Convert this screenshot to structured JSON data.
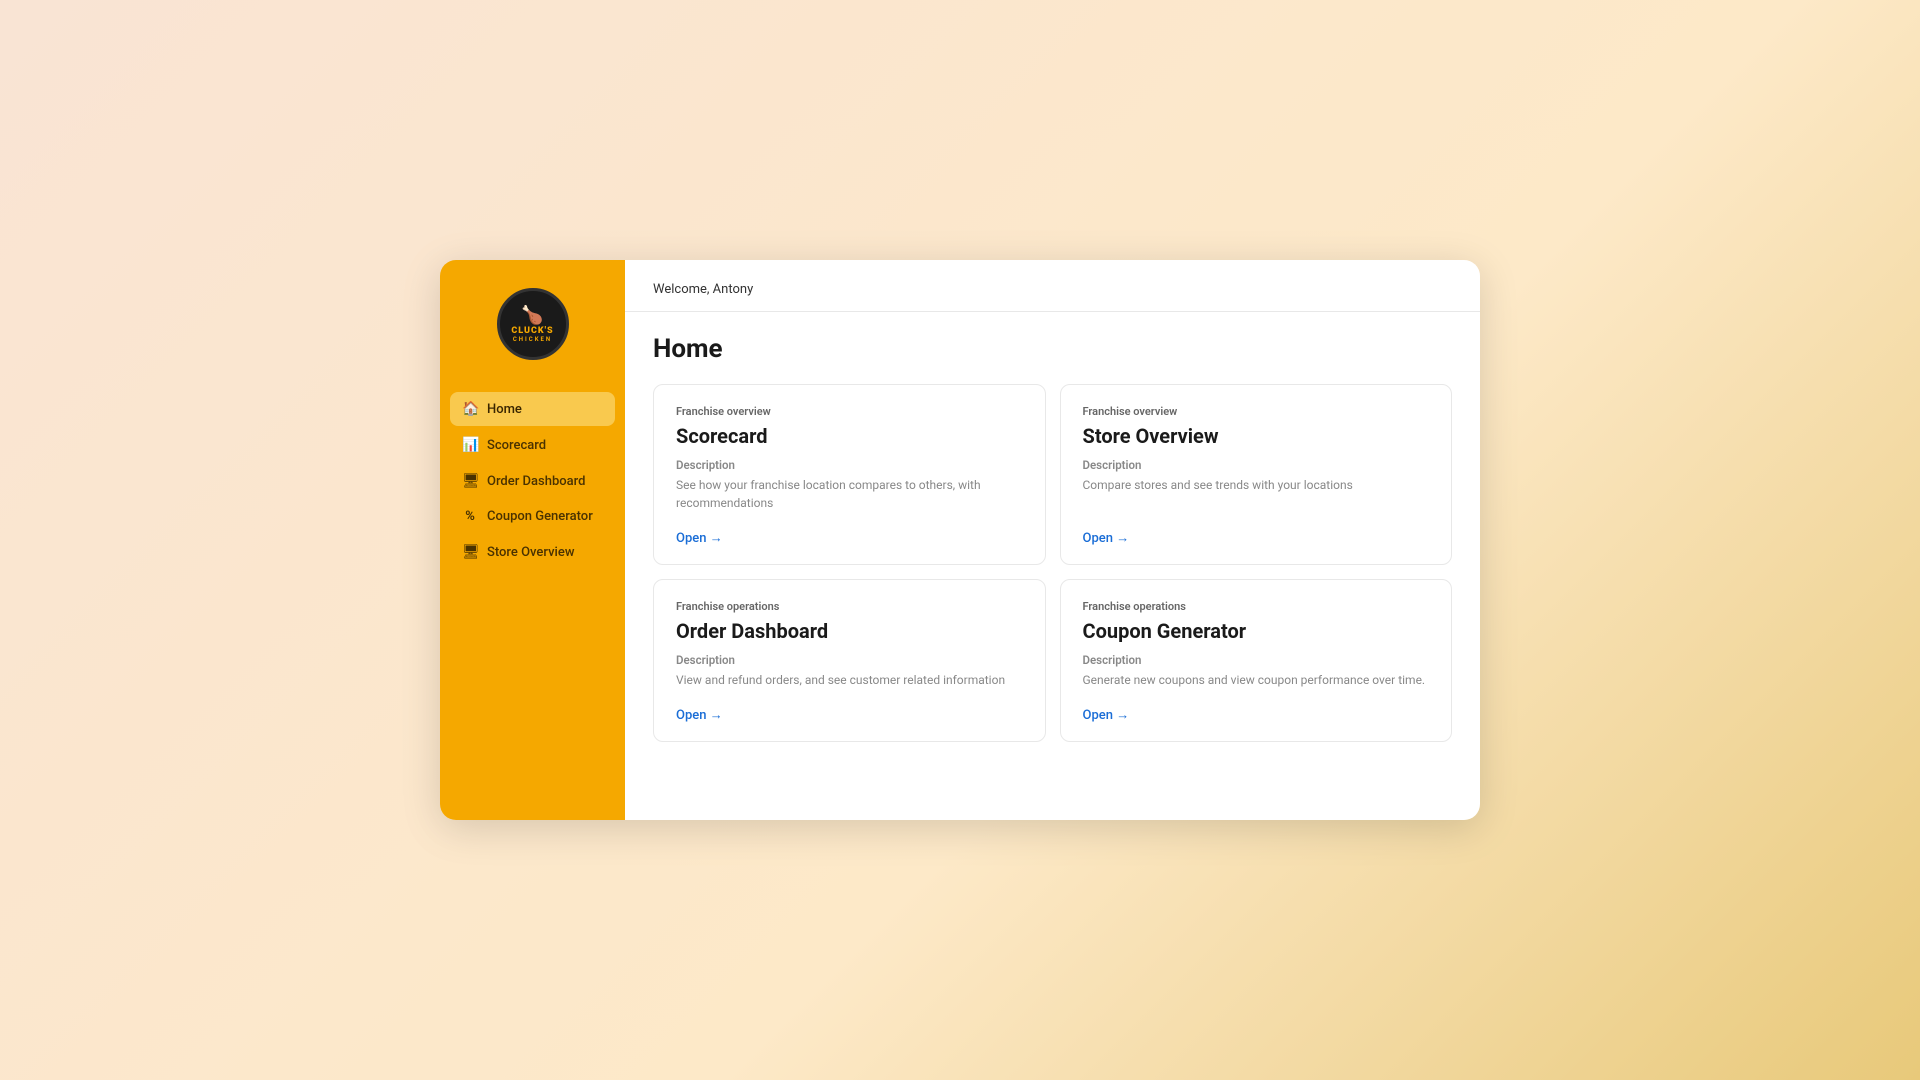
{
  "welcome": {
    "text": "Welcome, Antony"
  },
  "page": {
    "title": "Home"
  },
  "logo": {
    "line1": "CLUCK'S",
    "line2": "CHICKEN",
    "icon": "🍗"
  },
  "sidebar": {
    "items": [
      {
        "id": "home",
        "label": "Home",
        "icon": "🏠",
        "active": true
      },
      {
        "id": "scorecard",
        "label": "Scorecard",
        "icon": "📊",
        "active": false
      },
      {
        "id": "order-dashboard",
        "label": "Order Dashboard",
        "icon": "🖥",
        "active": false
      },
      {
        "id": "coupon-generator",
        "label": "Coupon Generator",
        "icon": "%",
        "active": false
      },
      {
        "id": "store-overview",
        "label": "Store Overview",
        "icon": "🖥",
        "active": false
      }
    ]
  },
  "cards": [
    {
      "id": "scorecard",
      "category": "Franchise overview",
      "title": "Scorecard",
      "desc_label": "Description",
      "description": "See how your franchise location compares to others, with recommendations",
      "open_label": "Open →"
    },
    {
      "id": "store-overview",
      "category": "Franchise overview",
      "title": "Store Overview",
      "desc_label": "Description",
      "description": "Compare stores and see trends with your locations",
      "open_label": "Open →"
    },
    {
      "id": "order-dashboard",
      "category": "Franchise operations",
      "title": "Order Dashboard",
      "desc_label": "Description",
      "description": "View and refund orders, and see customer related information",
      "open_label": "Open →"
    },
    {
      "id": "coupon-generator",
      "category": "Franchise operations",
      "title": "Coupon Generator",
      "desc_label": "Description",
      "description": "Generate new coupons and view coupon performance over time.",
      "open_label": "Open →"
    }
  ]
}
